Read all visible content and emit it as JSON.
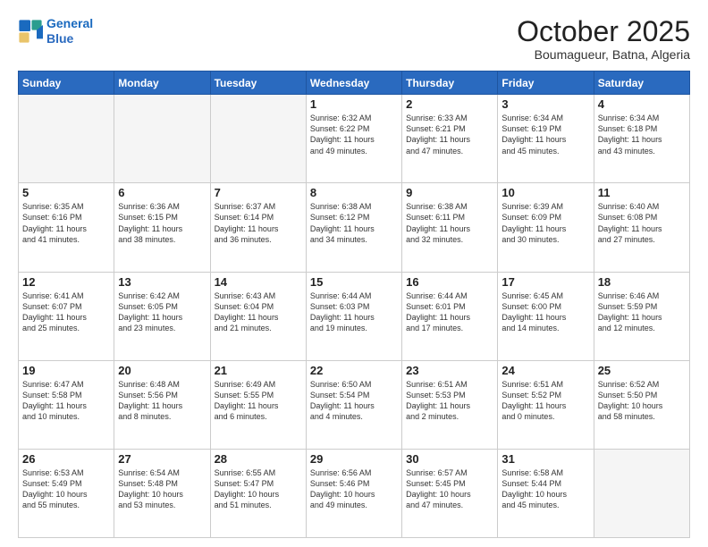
{
  "logo": {
    "line1": "General",
    "line2": "Blue"
  },
  "header": {
    "month": "October 2025",
    "location": "Boumagueur, Batna, Algeria"
  },
  "weekdays": [
    "Sunday",
    "Monday",
    "Tuesday",
    "Wednesday",
    "Thursday",
    "Friday",
    "Saturday"
  ],
  "weeks": [
    [
      {
        "day": "",
        "text": ""
      },
      {
        "day": "",
        "text": ""
      },
      {
        "day": "",
        "text": ""
      },
      {
        "day": "1",
        "text": "Sunrise: 6:32 AM\nSunset: 6:22 PM\nDaylight: 11 hours\nand 49 minutes."
      },
      {
        "day": "2",
        "text": "Sunrise: 6:33 AM\nSunset: 6:21 PM\nDaylight: 11 hours\nand 47 minutes."
      },
      {
        "day": "3",
        "text": "Sunrise: 6:34 AM\nSunset: 6:19 PM\nDaylight: 11 hours\nand 45 minutes."
      },
      {
        "day": "4",
        "text": "Sunrise: 6:34 AM\nSunset: 6:18 PM\nDaylight: 11 hours\nand 43 minutes."
      }
    ],
    [
      {
        "day": "5",
        "text": "Sunrise: 6:35 AM\nSunset: 6:16 PM\nDaylight: 11 hours\nand 41 minutes."
      },
      {
        "day": "6",
        "text": "Sunrise: 6:36 AM\nSunset: 6:15 PM\nDaylight: 11 hours\nand 38 minutes."
      },
      {
        "day": "7",
        "text": "Sunrise: 6:37 AM\nSunset: 6:14 PM\nDaylight: 11 hours\nand 36 minutes."
      },
      {
        "day": "8",
        "text": "Sunrise: 6:38 AM\nSunset: 6:12 PM\nDaylight: 11 hours\nand 34 minutes."
      },
      {
        "day": "9",
        "text": "Sunrise: 6:38 AM\nSunset: 6:11 PM\nDaylight: 11 hours\nand 32 minutes."
      },
      {
        "day": "10",
        "text": "Sunrise: 6:39 AM\nSunset: 6:09 PM\nDaylight: 11 hours\nand 30 minutes."
      },
      {
        "day": "11",
        "text": "Sunrise: 6:40 AM\nSunset: 6:08 PM\nDaylight: 11 hours\nand 27 minutes."
      }
    ],
    [
      {
        "day": "12",
        "text": "Sunrise: 6:41 AM\nSunset: 6:07 PM\nDaylight: 11 hours\nand 25 minutes."
      },
      {
        "day": "13",
        "text": "Sunrise: 6:42 AM\nSunset: 6:05 PM\nDaylight: 11 hours\nand 23 minutes."
      },
      {
        "day": "14",
        "text": "Sunrise: 6:43 AM\nSunset: 6:04 PM\nDaylight: 11 hours\nand 21 minutes."
      },
      {
        "day": "15",
        "text": "Sunrise: 6:44 AM\nSunset: 6:03 PM\nDaylight: 11 hours\nand 19 minutes."
      },
      {
        "day": "16",
        "text": "Sunrise: 6:44 AM\nSunset: 6:01 PM\nDaylight: 11 hours\nand 17 minutes."
      },
      {
        "day": "17",
        "text": "Sunrise: 6:45 AM\nSunset: 6:00 PM\nDaylight: 11 hours\nand 14 minutes."
      },
      {
        "day": "18",
        "text": "Sunrise: 6:46 AM\nSunset: 5:59 PM\nDaylight: 11 hours\nand 12 minutes."
      }
    ],
    [
      {
        "day": "19",
        "text": "Sunrise: 6:47 AM\nSunset: 5:58 PM\nDaylight: 11 hours\nand 10 minutes."
      },
      {
        "day": "20",
        "text": "Sunrise: 6:48 AM\nSunset: 5:56 PM\nDaylight: 11 hours\nand 8 minutes."
      },
      {
        "day": "21",
        "text": "Sunrise: 6:49 AM\nSunset: 5:55 PM\nDaylight: 11 hours\nand 6 minutes."
      },
      {
        "day": "22",
        "text": "Sunrise: 6:50 AM\nSunset: 5:54 PM\nDaylight: 11 hours\nand 4 minutes."
      },
      {
        "day": "23",
        "text": "Sunrise: 6:51 AM\nSunset: 5:53 PM\nDaylight: 11 hours\nand 2 minutes."
      },
      {
        "day": "24",
        "text": "Sunrise: 6:51 AM\nSunset: 5:52 PM\nDaylight: 11 hours\nand 0 minutes."
      },
      {
        "day": "25",
        "text": "Sunrise: 6:52 AM\nSunset: 5:50 PM\nDaylight: 10 hours\nand 58 minutes."
      }
    ],
    [
      {
        "day": "26",
        "text": "Sunrise: 6:53 AM\nSunset: 5:49 PM\nDaylight: 10 hours\nand 55 minutes."
      },
      {
        "day": "27",
        "text": "Sunrise: 6:54 AM\nSunset: 5:48 PM\nDaylight: 10 hours\nand 53 minutes."
      },
      {
        "day": "28",
        "text": "Sunrise: 6:55 AM\nSunset: 5:47 PM\nDaylight: 10 hours\nand 51 minutes."
      },
      {
        "day": "29",
        "text": "Sunrise: 6:56 AM\nSunset: 5:46 PM\nDaylight: 10 hours\nand 49 minutes."
      },
      {
        "day": "30",
        "text": "Sunrise: 6:57 AM\nSunset: 5:45 PM\nDaylight: 10 hours\nand 47 minutes."
      },
      {
        "day": "31",
        "text": "Sunrise: 6:58 AM\nSunset: 5:44 PM\nDaylight: 10 hours\nand 45 minutes."
      },
      {
        "day": "",
        "text": ""
      }
    ]
  ]
}
